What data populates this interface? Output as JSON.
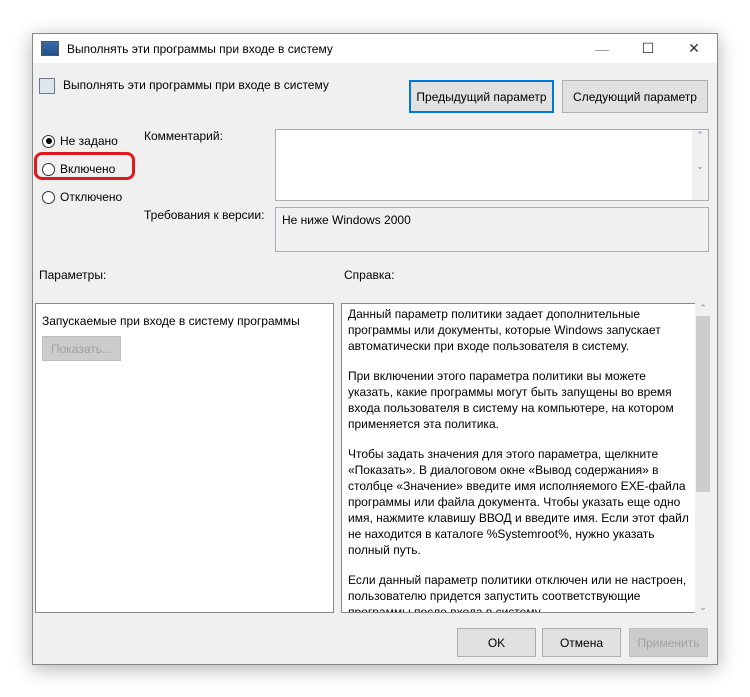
{
  "window": {
    "title": "Выполнять эти программы при входе в систему",
    "minimize": "—",
    "maximize": "☐",
    "close": "✕"
  },
  "header": {
    "policy_name": "Выполнять эти программы при входе в систему",
    "prev_button": "Предыдущий параметр",
    "next_button": "Следующий параметр"
  },
  "state": {
    "options": [
      {
        "label": "Не задано",
        "selected": true
      },
      {
        "label": "Включено",
        "selected": false,
        "highlighted": true
      },
      {
        "label": "Отключено",
        "selected": false
      }
    ],
    "highlight_color": "#e0191e"
  },
  "comment": {
    "label": "Комментарий:",
    "value": ""
  },
  "version": {
    "label": "Требования к версии:",
    "value": "Не ниже Windows 2000"
  },
  "params": {
    "label": "Параметры:",
    "item": "Запускаемые при входе в систему программы",
    "show_button": "Показать..."
  },
  "help": {
    "label": "Справка:",
    "paragraphs": [
      "Данный параметр политики задает дополнительные программы или документы, которые Windows запускает автоматически при входе пользователя в систему.",
      "При включении этого параметра политики вы можете указать, какие программы могут быть запущены во время входа пользователя в систему на компьютере, на котором применяется эта политика.",
      "Чтобы задать значения для этого параметра, щелкните «Показать». В диалоговом окне «Вывод содержания» в столбце «Значение» введите имя исполняемого EXE-файла программы или файла документа. Чтобы указать еще одно имя, нажмите клавишу ВВОД и введите имя. Если этот файл не находится в каталоге %Systemroot%, нужно указать полный путь.",
      "Если данный параметр политики отключен или не настроен, пользователю придется запустить соответствующие программы после входа в систему."
    ]
  },
  "footer": {
    "ok": "OK",
    "cancel": "Отмена",
    "apply": "Применить"
  }
}
